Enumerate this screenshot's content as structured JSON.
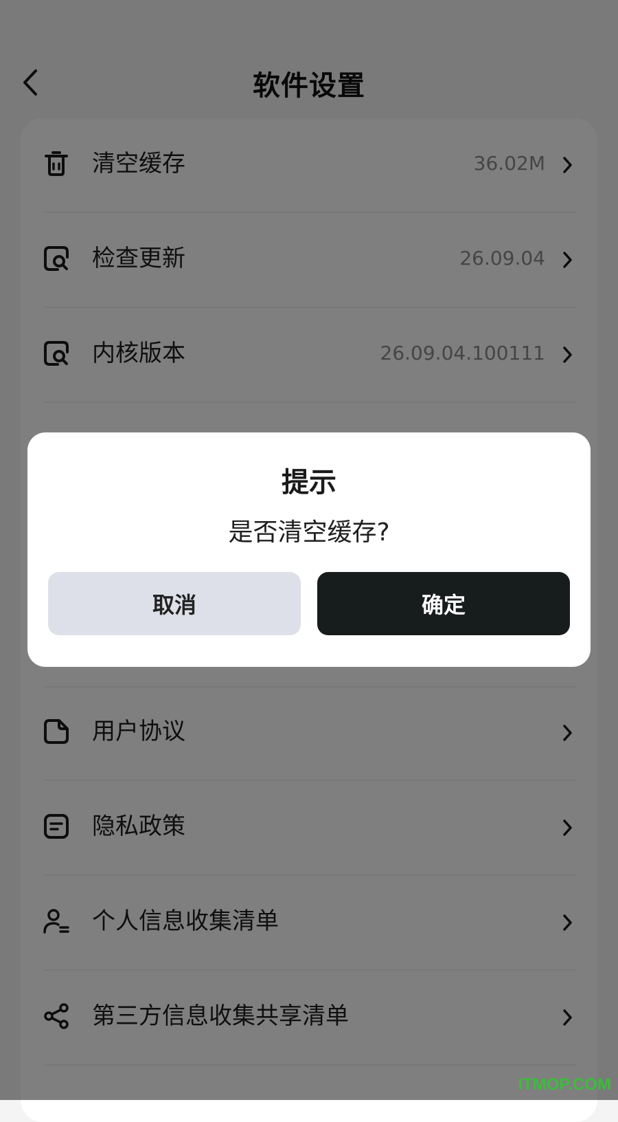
{
  "header": {
    "title": "软件设置",
    "back_icon": "chevron-left-icon"
  },
  "settings": {
    "items": [
      {
        "label": "清空缓存",
        "value": "36.02M",
        "icon": "trash-icon"
      },
      {
        "label": "检查更新",
        "value": "26.09.04",
        "icon": "search-doc-icon"
      },
      {
        "label": "内核版本",
        "value": "26.09.04.100111",
        "icon": "search-doc-icon"
      },
      {
        "label": "用户协议",
        "value": "",
        "icon": "document-icon"
      },
      {
        "label": "隐私政策",
        "value": "",
        "icon": "note-icon"
      },
      {
        "label": "个人信息收集清单",
        "value": "",
        "icon": "user-list-icon"
      },
      {
        "label": "第三方信息收集共享清单",
        "value": "",
        "icon": "share-icon"
      }
    ]
  },
  "dialog": {
    "title": "提示",
    "message": "是否清空缓存?",
    "cancel_label": "取消",
    "confirm_label": "确定"
  },
  "colors": {
    "overlay": "#000000",
    "confirm_button": "#171c1d",
    "cancel_button": "#dde0e8",
    "watermark": "#3bbd3b"
  },
  "watermark": "ITMOP.COM"
}
